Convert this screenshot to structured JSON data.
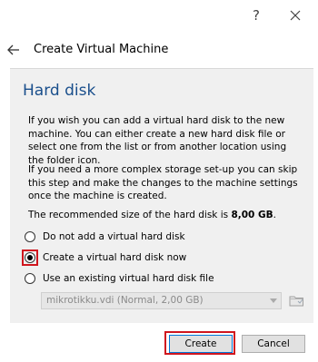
{
  "titlebar": {
    "help_glyph": "?",
    "close_icon": "close-icon"
  },
  "header": {
    "title": "Create Virtual Machine",
    "back_icon": "back-arrow-icon"
  },
  "section": {
    "title": "Hard disk",
    "desc1": "If you wish you can add a virtual hard disk to the new machine. You can either create a new hard disk file or select one from the list or from another location using the folder icon.",
    "desc2": "If you need a more complex storage set-up you can skip this step and make the changes to the machine settings once the machine is created.",
    "recommended_prefix": "The recommended size of the hard disk is ",
    "recommended_value": "8,00 GB",
    "recommended_suffix": "."
  },
  "options": [
    {
      "label": "Do not add a virtual hard disk",
      "checked": false
    },
    {
      "label": "Create a virtual hard disk now",
      "checked": true
    },
    {
      "label": "Use an existing virtual hard disk file",
      "checked": false
    }
  ],
  "existing_disk": {
    "value": "mikrotikku.vdi (Normal, 2,00 GB)",
    "folder_icon": "folder-icon"
  },
  "buttons": {
    "create": "Create",
    "cancel": "Cancel"
  },
  "colors": {
    "accent_title": "#1a4f8c",
    "highlight": "#d0161e",
    "focus_border": "#0078d7"
  }
}
